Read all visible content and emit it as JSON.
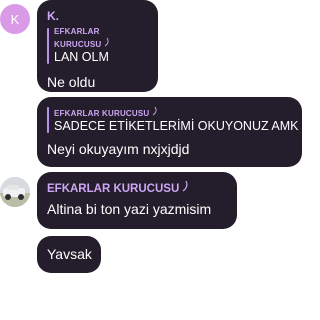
{
  "messages": [
    {
      "avatar_letter": "K",
      "sender": "K.",
      "reply_author": "EFKARLAR KURUCUSU",
      "reply_text": "LAN OLM",
      "text": "Ne oldu"
    },
    {
      "reply_author": "EFKARLAR KURUCUSU",
      "reply_text": "SADECE ETİKETLERİMİ OKUYONUZ AMK",
      "text": "Neyi okuyayım nxjxjdjd"
    },
    {
      "sender": "EFKARLAR KURUCUSU",
      "text": "Altina bi ton yazi yazmisim"
    },
    {
      "text": "Yavsak"
    }
  ],
  "colors": {
    "bubble": "#241d2b",
    "name": "#cda7f3",
    "avatar_k": "#d99be8"
  }
}
